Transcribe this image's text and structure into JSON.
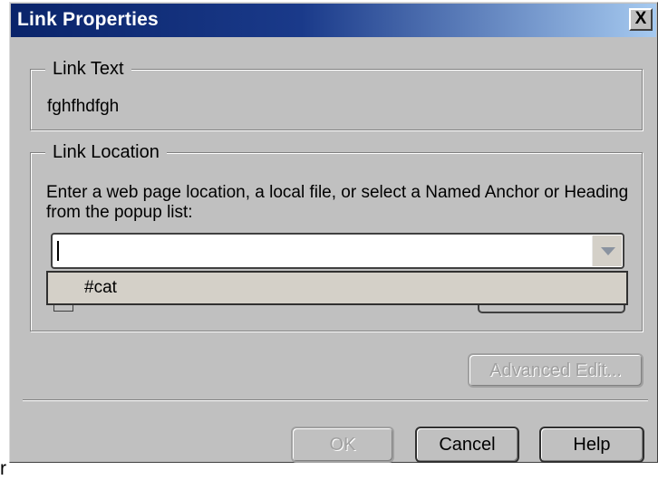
{
  "window": {
    "title": "Link Properties",
    "close_glyph": "X"
  },
  "link_text_group": {
    "legend": "Link Text",
    "value": "fghfhdfgh"
  },
  "link_location_group": {
    "legend": "Link Location",
    "instructions": "Enter a web page location, a local file, or select a Named Anchor or Heading from the popup list:",
    "location_input_value": "",
    "dropdown_items": [
      "#cat"
    ]
  },
  "buttons": {
    "advanced_edit": "Advanced Edit...",
    "ok": "OK",
    "cancel": "Cancel",
    "help": "Help"
  },
  "stray_text": "r",
  "colors": {
    "title_gradient_start": "#0a246a",
    "title_gradient_end": "#a6caf0",
    "dialog_face": "#c0c0c0",
    "disabled_text": "#a0a0a0"
  }
}
